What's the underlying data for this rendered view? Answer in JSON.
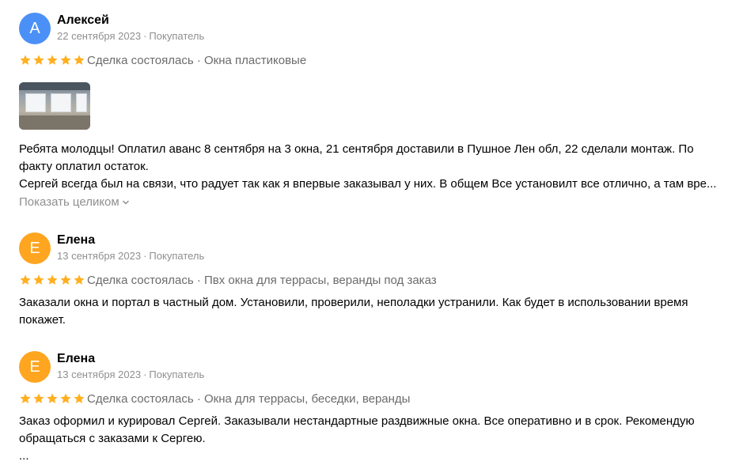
{
  "reviews": [
    {
      "author": "Алексей",
      "avatar_letter": "А",
      "avatar_color": "#4a90f7",
      "date": "22 сентября 2023",
      "role": "Покупатель",
      "rating": 5,
      "deal": "Сделка состоялась · Окна пластиковые",
      "has_photo": true,
      "text_lines": [
        "Ребята молодцы! Оплатил аванс 8 сентября на 3 окна, 21 сентября доставили в Пушное Лен обл, 22 сделали монтаж. По",
        "факту оплатил остаток.",
        "Сергей всегда был на связи, что радует так как я впервые заказывал у них. В общем Все установилт все отлично, а там вре..."
      ],
      "show_more": "Показать целиком"
    },
    {
      "author": "Елена",
      "avatar_letter": "Е",
      "avatar_color": "#ffa51f",
      "date": "13 сентября 2023",
      "role": "Покупатель",
      "rating": 5,
      "deal": "Сделка состоялась · Пвх окна для террасы, веранды под заказ",
      "text_lines": [
        "Заказали окна и портал в частный дом. Установили, проверили, неполадки устранили. Как будет в использовании время",
        "покажет."
      ]
    },
    {
      "author": "Елена",
      "avatar_letter": "Е",
      "avatar_color": "#ffa51f",
      "date": "13 сентября 2023",
      "role": "Покупатель",
      "rating": 5,
      "deal": "Сделка состоялась · Окна для террасы, беседки, веранды",
      "text_lines": [
        "Заказ оформил и курировал Сергей. Заказывали нестандартные раздвижные окна. Все оперативно и в срок. Рекомендую",
        "обращаться с заказами к Сергею.",
        "..."
      ]
    }
  ],
  "meta_separator": "·",
  "star_color": "#ffb021",
  "icons": {
    "star": "star-icon",
    "chevron": "chevron-down-icon"
  }
}
